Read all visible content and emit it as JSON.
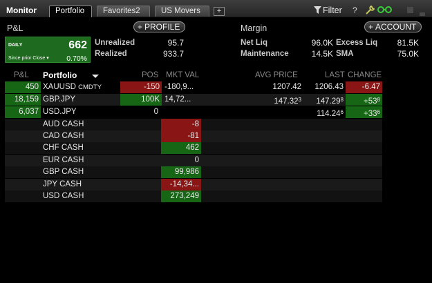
{
  "window": {
    "title": "Monitor",
    "tabs": [
      {
        "label": "Portfolio",
        "active": true
      },
      {
        "label": "Favorites2",
        "active": false
      },
      {
        "label": "US Movers",
        "active": false
      }
    ],
    "add_tab": "+",
    "filter_label": "Filter",
    "help_icon": "?",
    "icons": [
      "filter-icon",
      "help-icon",
      "wrench-icon",
      "link-icon",
      "minimize-icon"
    ]
  },
  "pnl": {
    "label": "P&L",
    "profile_button": "PROFILE",
    "daily_label": "DAILY",
    "daily_value": "662",
    "since_label": "Since prior Close",
    "daily_pct": "0.70%",
    "unrealized_label": "Unrealized",
    "unrealized_value": "95.7",
    "realized_label": "Realized",
    "realized_value": "933.7"
  },
  "margin": {
    "label": "Margin",
    "account_button": "ACCOUNT",
    "net_liq_label": "Net Liq",
    "net_liq_value": "96.0K",
    "excess_liq_label": "Excess Liq",
    "excess_liq_value": "81.5K",
    "maintenance_label": "Maintenance",
    "maintenance_value": "14.5K",
    "sma_label": "SMA",
    "sma_value": "75.0K"
  },
  "table": {
    "headers": {
      "pnl": "P&L",
      "portfolio": "Portfolio",
      "pos": "POS",
      "mkt_val": "MKT VAL",
      "avg_price": "AVG PRICE",
      "last": "LAST",
      "change": "CHANGE"
    },
    "positions": [
      {
        "pnl": "450",
        "symbol": "XAUUSD",
        "type": "CMDTY",
        "pos": "-150",
        "mkt_val": "-180,9...",
        "avg_price": "1207.42",
        "avg_sup": "",
        "last": "1206.43",
        "last_sup": "",
        "change": "-6.47",
        "change_sup": "",
        "change_dir": "down"
      },
      {
        "pnl": "18,159",
        "symbol": "GBP.JPY",
        "type": "",
        "pos": "100K",
        "mkt_val": "14,72...",
        "avg_price": "147.32",
        "avg_sup": "3",
        "last": "147.29",
        "last_sup": "8",
        "change": "+53",
        "change_sup": "8",
        "change_dir": "up"
      },
      {
        "pnl": "6,037",
        "symbol": "USD.JPY",
        "type": "",
        "pos": "0",
        "mkt_val": "",
        "avg_price": "",
        "avg_sup": "",
        "last": "114.24",
        "last_sup": "6",
        "change": "+33",
        "change_sup": "6",
        "change_dir": "up"
      }
    ],
    "cash": [
      {
        "label": "AUD CASH",
        "value": "-8",
        "dir": "down"
      },
      {
        "label": "CAD CASH",
        "value": "-81",
        "dir": "down"
      },
      {
        "label": "CHF CASH",
        "value": "462",
        "dir": "up"
      },
      {
        "label": "EUR CASH",
        "value": "0",
        "dir": "flat"
      },
      {
        "label": "GBP CASH",
        "value": "99,986",
        "dir": "up"
      },
      {
        "label": "JPY CASH",
        "value": "-14,34...",
        "dir": "down"
      },
      {
        "label": "USD CASH",
        "value": "273,249",
        "dir": "up"
      }
    ]
  },
  "colors": {
    "gain": "#166616",
    "loss": "#8a1515",
    "background": "#000000"
  }
}
